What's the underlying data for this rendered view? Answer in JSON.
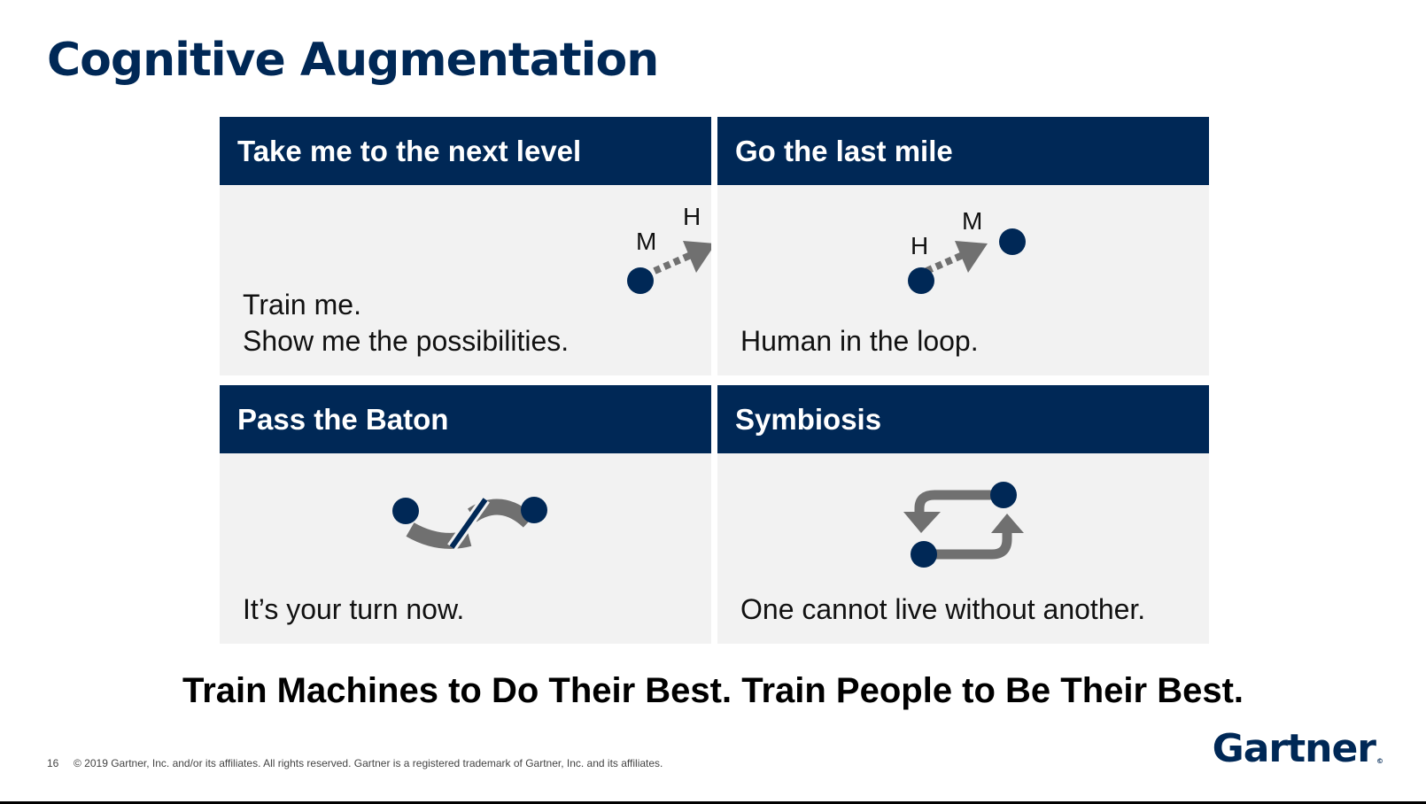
{
  "slide": {
    "title": "Cognitive Augmentation",
    "tagline": "Train Machines to Do Their Best. Train People to Be Their Best.",
    "page_number": "16",
    "copyright": "© 2019 Gartner, Inc. and/or its affiliates. All rights reserved. Gartner is a registered trademark of Gartner, Inc. and its affiliates.",
    "brand": "Gartner",
    "brand_mark": "©"
  },
  "quadrants": [
    {
      "heading": "Take me to the next level",
      "lines": [
        "Train me.",
        "Show me the possibilities."
      ],
      "icon": "machine-to-human-arrow-icon",
      "labels": [
        "M",
        "H"
      ]
    },
    {
      "heading": "Go the last mile",
      "lines": [
        "Human in the loop."
      ],
      "icon": "human-to-machine-arrow-icon",
      "labels": [
        "H",
        "M"
      ]
    },
    {
      "heading": "Pass the Baton",
      "lines": [
        "It’s your turn now."
      ],
      "icon": "baton-handoff-icon"
    },
    {
      "heading": "Symbiosis",
      "lines": [
        "One cannot live without another."
      ],
      "icon": "symbiosis-cycle-icon"
    }
  ],
  "colors": {
    "navy": "#002856",
    "gray_arrow": "#707070",
    "panel_bg": "#f2f2f2"
  }
}
